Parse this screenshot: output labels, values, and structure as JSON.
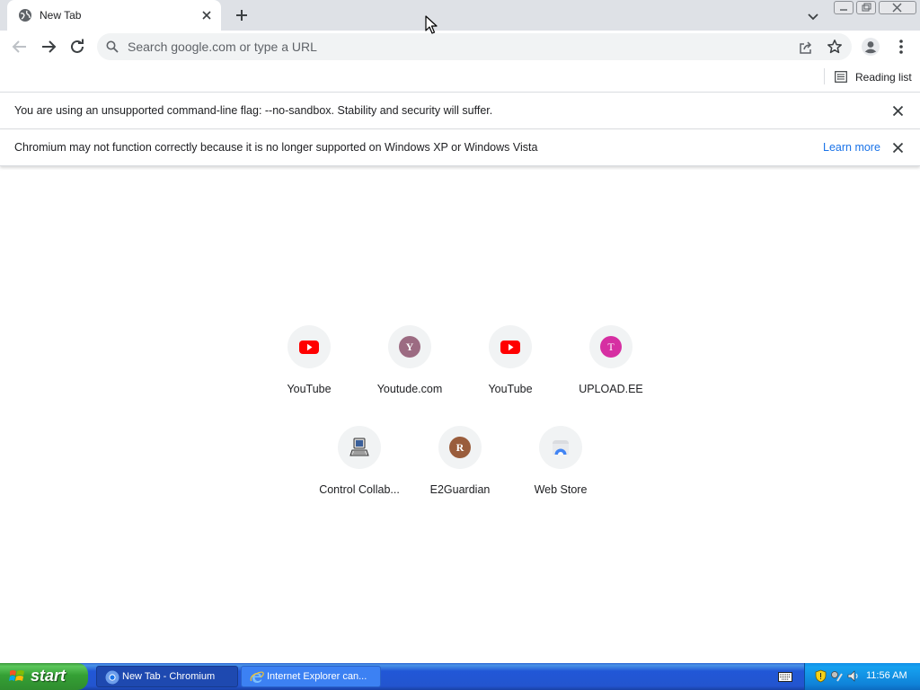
{
  "browser": {
    "tab": {
      "title": "New Tab"
    },
    "omnibox": {
      "placeholder": "Search google.com or type a URL",
      "value": ""
    },
    "bookmarks_bar": {
      "reading_list_label": "Reading list"
    },
    "infobars": [
      {
        "message": "You are using an unsupported command-line flag: --no-sandbox. Stability and security will suffer."
      },
      {
        "message": "Chromium may not function correctly because it is no longer supported on Windows XP or Windows Vista",
        "link": "Learn more"
      }
    ],
    "shortcuts": [
      {
        "label": "YouTube",
        "icon": "youtube-icon"
      },
      {
        "label": "Youtude.com",
        "letter": "Y",
        "color": "#9c6b82"
      },
      {
        "label": "YouTube",
        "icon": "youtube-icon"
      },
      {
        "label": "UPLOAD.EE",
        "letter": "T",
        "color": "#d62fa2"
      },
      {
        "label": "Control Collab...",
        "icon": "computer-icon"
      },
      {
        "label": "E2Guardian",
        "letter": "R",
        "color": "#9a5d3c"
      },
      {
        "label": "Web Store",
        "icon": "web-store-icon"
      }
    ]
  },
  "taskbar": {
    "start_label": "start",
    "tasks": [
      {
        "label": "New Tab - Chromium",
        "icon": "chromium-icon"
      },
      {
        "label": "Internet Explorer can...",
        "icon": "ie-icon"
      }
    ],
    "clock": "11:56 AM"
  },
  "colors": {
    "youtube_red": "#ff0000",
    "link_blue": "#1a73e8",
    "taskbar_blue": "#2355cf",
    "start_green": "#35a035"
  }
}
